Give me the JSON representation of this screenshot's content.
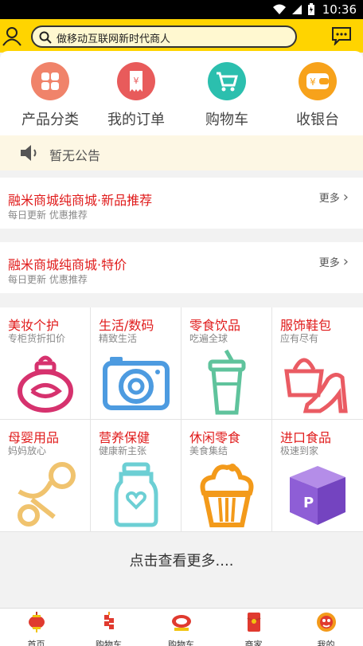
{
  "status_bar": {
    "time": "10:36"
  },
  "header": {
    "search_placeholder": "做移动互联网新时代商人"
  },
  "quick_nav": [
    {
      "label": "产品分类",
      "icon": "grid-icon",
      "color": "#f0836a"
    },
    {
      "label": "我的订单",
      "icon": "receipt-icon",
      "color": "#e85b5b"
    },
    {
      "label": "购物车",
      "icon": "cart-icon",
      "color": "#2bbfae"
    },
    {
      "label": "收银台",
      "icon": "cashier-icon",
      "color": "#f7a21b"
    }
  ],
  "notice": {
    "text": "暂无公告"
  },
  "promos": [
    {
      "title": "融米商城纯商城·新品推荐",
      "subtitle": "每日更新 优惠推荐",
      "more": "更多"
    },
    {
      "title": "融米商城纯商城·特价",
      "subtitle": "每日更新 优惠推荐",
      "more": "更多"
    }
  ],
  "categories": [
    {
      "name": "美妆个护",
      "sub": "专柜货折扣价",
      "icon": "perfume-icon",
      "color": "#d6326e"
    },
    {
      "name": "生活/数码",
      "sub": "精致生活",
      "icon": "camera-icon",
      "color": "#4d9be0"
    },
    {
      "name": "零食饮品",
      "sub": "吃遍全球",
      "icon": "drink-cup-icon",
      "color": "#5fc39c"
    },
    {
      "name": "服饰鞋包",
      "sub": "应有尽有",
      "icon": "handbag-heel-icon",
      "color": "#ea5b63"
    },
    {
      "name": "母婴用品",
      "sub": "妈妈放心",
      "icon": "pacifier-icon",
      "color": "#f0c36e"
    },
    {
      "name": "营养保健",
      "sub": "健康新主张",
      "icon": "jar-icon",
      "color": "#6ccfd4"
    },
    {
      "name": "休闲零食",
      "sub": "美食集结",
      "icon": "cupcake-icon",
      "color": "#f39a1a"
    },
    {
      "name": "进口食品",
      "sub": "极速到家",
      "icon": "package-box-icon",
      "color": "#8e5ed6"
    }
  ],
  "more_link": "点击查看更多....",
  "tabs": [
    {
      "label": "首页",
      "icon": "lantern-icon"
    },
    {
      "label": "购物车",
      "icon": "firecracker-icon"
    },
    {
      "label": "购物车",
      "icon": "shopping-logo-icon"
    },
    {
      "label": "商家",
      "icon": "red-envelope-icon"
    },
    {
      "label": "我的",
      "icon": "lion-head-icon"
    }
  ]
}
